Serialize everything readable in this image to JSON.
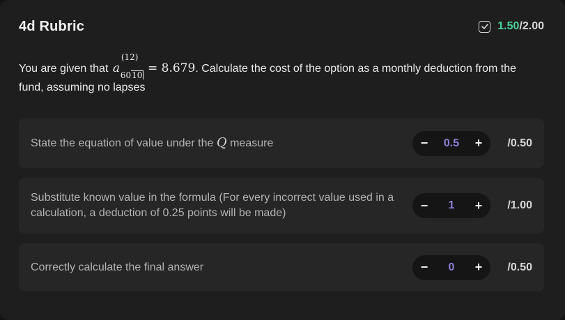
{
  "header": {
    "title": "4d Rubric",
    "score_earned": "1.50",
    "score_separator": "/",
    "score_total": "2.00"
  },
  "question": {
    "prefix": "You are given that",
    "math_symbol": "a",
    "math_superscript": "(12)",
    "math_subscript_term": "60",
    "math_subscript_angle": "10",
    "math_rhs": "= 8.679",
    "suffix": ". Calculate the cost of the option as a monthly deduction from the fund, assuming no lapses"
  },
  "criteria": [
    {
      "label_before": "State the equation of value under the",
      "label_symbol": "Q",
      "label_after": "measure",
      "minus": "−",
      "value": "0.5",
      "plus": "+",
      "max": "/0.50"
    },
    {
      "label": "Substitute known value in the formula (For every incorrect value used in a calculation, a deduction of 0.25 points will be made)",
      "minus": "−",
      "value": "1",
      "plus": "+",
      "max": "/1.00"
    },
    {
      "label": "Correctly calculate the final answer",
      "minus": "−",
      "value": "0",
      "plus": "+",
      "max": "/0.50"
    }
  ],
  "icons": {
    "score_icon": "checkbox-checked-icon"
  },
  "colors": {
    "score_earned": "#4cd39b",
    "stepper_value": "#8e7ed6"
  }
}
